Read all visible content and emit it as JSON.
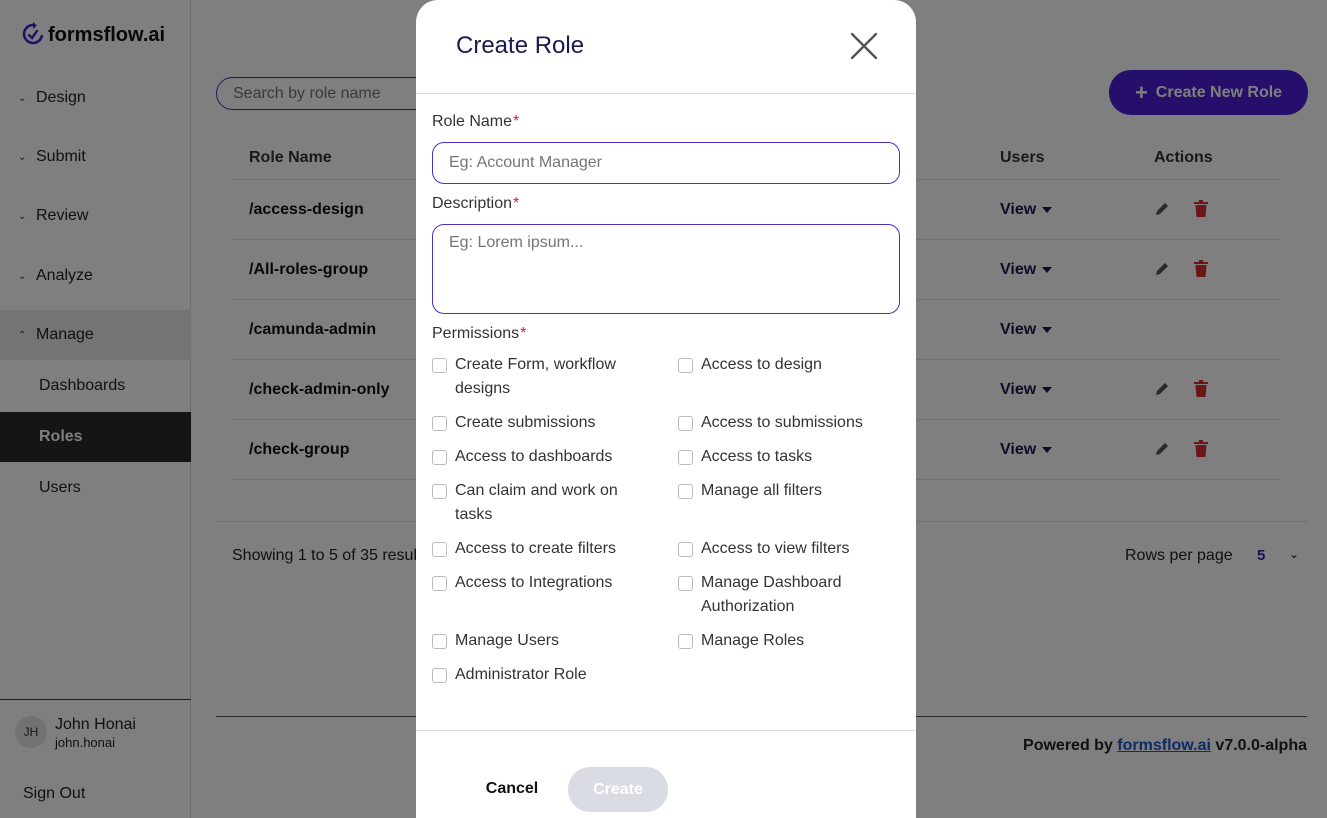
{
  "app": {
    "logo_text": "formsflow.ai"
  },
  "sidebar": {
    "items": [
      {
        "label": "Design"
      },
      {
        "label": "Submit"
      },
      {
        "label": "Review"
      },
      {
        "label": "Analyze"
      },
      {
        "label": "Manage"
      }
    ],
    "sub_items": [
      {
        "label": "Dashboards"
      },
      {
        "label": "Roles"
      },
      {
        "label": "Users"
      }
    ],
    "user": {
      "initials": "JH",
      "name": "John Honai",
      "handle": "john.honai"
    },
    "sign_out": "Sign Out"
  },
  "main": {
    "search_placeholder": "Search by role name",
    "create_button": "Create New Role",
    "table": {
      "headers": {
        "role_name": "Role Name",
        "users": "Users",
        "actions": "Actions"
      },
      "rows": [
        {
          "name": "/access-design",
          "view": "View"
        },
        {
          "name": "/All-roles-group",
          "view": "View"
        },
        {
          "name": "/camunda-admin",
          "view": "View"
        },
        {
          "name": "/check-admin-only",
          "view": "View"
        },
        {
          "name": "/check-group",
          "view": "View"
        }
      ]
    },
    "pagination": {
      "showing": "Showing 1 to 5 of 35 results",
      "rows_label": "Rows per page",
      "rows_value": "5"
    },
    "footer": {
      "powered_prefix": "Powered by",
      "link_text": "formsflow.ai",
      "version": "v7.0.0-alpha"
    }
  },
  "modal": {
    "title": "Create Role",
    "role_name_label": "Role Name",
    "role_name_placeholder": "Eg: Account Manager",
    "description_label": "Description",
    "description_placeholder": "Eg: Lorem ipsum...",
    "permissions_label": "Permissions",
    "required_mark": "*",
    "permissions_left": [
      "Create Form, workflow designs",
      "Create submissions",
      "Access to dashboards",
      "Can claim and work on tasks",
      "Access to create filters",
      "Access to Integrations",
      "Manage Users",
      "Administrator Role"
    ],
    "permissions_right": [
      "Access to design",
      "Access to submissions",
      "Access to tasks",
      "Manage all filters",
      "Access to view filters",
      "Manage Dashboard Authorization",
      "Manage Roles"
    ],
    "cancel_label": "Cancel",
    "create_label": "Create"
  },
  "colors": {
    "brand": "#4a1fd6",
    "delete_icon": "#d32f2f",
    "required": "#dd2222",
    "active_nav": "#2a2a2a"
  }
}
